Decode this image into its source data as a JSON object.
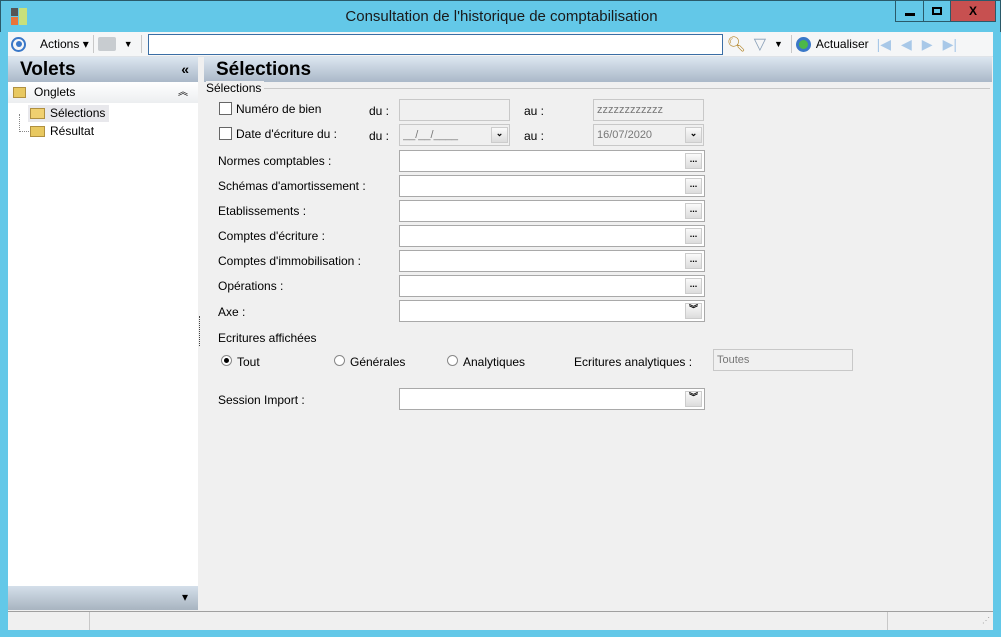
{
  "window": {
    "title": "Consultation de l'historique de comptabilisation",
    "minimize": "▁",
    "maximize": "□",
    "close": "X"
  },
  "toolbar": {
    "actions": "Actions",
    "search_value": "",
    "refresh": "Actualiser"
  },
  "left_panel": {
    "title": "Volets",
    "collapse": "«",
    "group": "Onglets",
    "group_toggle": "⌃",
    "items": [
      "Sélections",
      "Résultat"
    ],
    "bottom_arrow": "▾"
  },
  "main": {
    "title": "Sélections",
    "group_label": "Sélections",
    "numero": {
      "label": "Numéro de bien",
      "du": "du :",
      "du_value": "",
      "au": "au :",
      "au_value": "zzzzzzzzzzzz"
    },
    "date": {
      "label": "Date d'écriture du :",
      "du": "du :",
      "du_value": "__/__/____",
      "au": "au :",
      "au_value": "16/07/2020"
    },
    "fields": [
      {
        "label": "Normes comptables :",
        "value": ""
      },
      {
        "label": "Schémas d'amortissement :",
        "value": ""
      },
      {
        "label": "Etablissements :",
        "value": ""
      },
      {
        "label": "Comptes d'écriture :",
        "value": ""
      },
      {
        "label": "Comptes d'immobilisation :",
        "value": ""
      },
      {
        "label": "Opérations :",
        "value": ""
      }
    ],
    "axe": {
      "label": "Axe :",
      "value": ""
    },
    "ecritures": {
      "label": "Ecritures affichées",
      "options": [
        "Tout",
        "Générales",
        "Analytiques"
      ],
      "selected": "Tout",
      "analytiques_label": "Ecritures analytiques :",
      "analytiques_value": "Toutes"
    },
    "session": {
      "label": "Session Import :",
      "value": ""
    }
  }
}
